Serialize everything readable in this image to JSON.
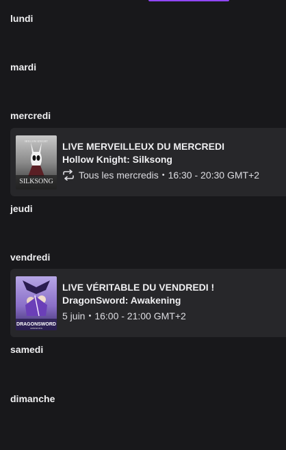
{
  "accent_color": "#9147ff",
  "days": [
    {
      "name": "lundi"
    },
    {
      "name": "mardi"
    },
    {
      "name": "mercredi"
    },
    {
      "name": "jeudi"
    },
    {
      "name": "vendredi"
    },
    {
      "name": "samedi"
    },
    {
      "name": "dimanche"
    }
  ],
  "events": [
    {
      "title": "LIVE MERVEILLEUX DU MERCREDI",
      "game": "Hollow Knight: Silksong",
      "recurring": true,
      "when": "Tous les mercredis",
      "time": "16:30 - 20:30 GMT+2",
      "cover_text": "SILKSONG",
      "cover_small": "HOLLOW KNIGHT"
    },
    {
      "title": "LIVE VÉRITABLE DU VENDREDI !",
      "game": "DragonSword: Awakening",
      "recurring": false,
      "when": "5 juin",
      "time": "16:00 - 21:00 GMT+2",
      "cover_text": "DRAGONSWORD",
      "cover_small": "AWAKENING"
    }
  ],
  "separator": "•"
}
